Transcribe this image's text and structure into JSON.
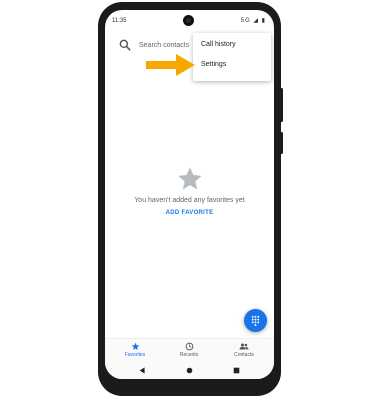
{
  "status_bar": {
    "time": "11:35",
    "icons": "5G ◢ ▮"
  },
  "search": {
    "placeholder": "Search contacts"
  },
  "overflow_menu": {
    "items": [
      {
        "label": "Call history"
      },
      {
        "label": "Settings"
      }
    ]
  },
  "empty_state": {
    "message": "You haven't added any favorites yet",
    "action": "ADD FAVORITE"
  },
  "bottom_nav": {
    "items": [
      {
        "label": "Favorites",
        "icon": "star-icon",
        "active": true
      },
      {
        "label": "Recents",
        "icon": "clock-icon",
        "active": false
      },
      {
        "label": "Contacts",
        "icon": "people-icon",
        "active": false
      }
    ]
  },
  "system_nav": {
    "icons": [
      "back-icon",
      "home-icon",
      "recents-icon"
    ]
  },
  "colors": {
    "accent": "#1a73e8",
    "annotation_arrow": "#f7a800",
    "star_gray": "#b6bbc0",
    "phone_frame": "#1b1b1d"
  }
}
